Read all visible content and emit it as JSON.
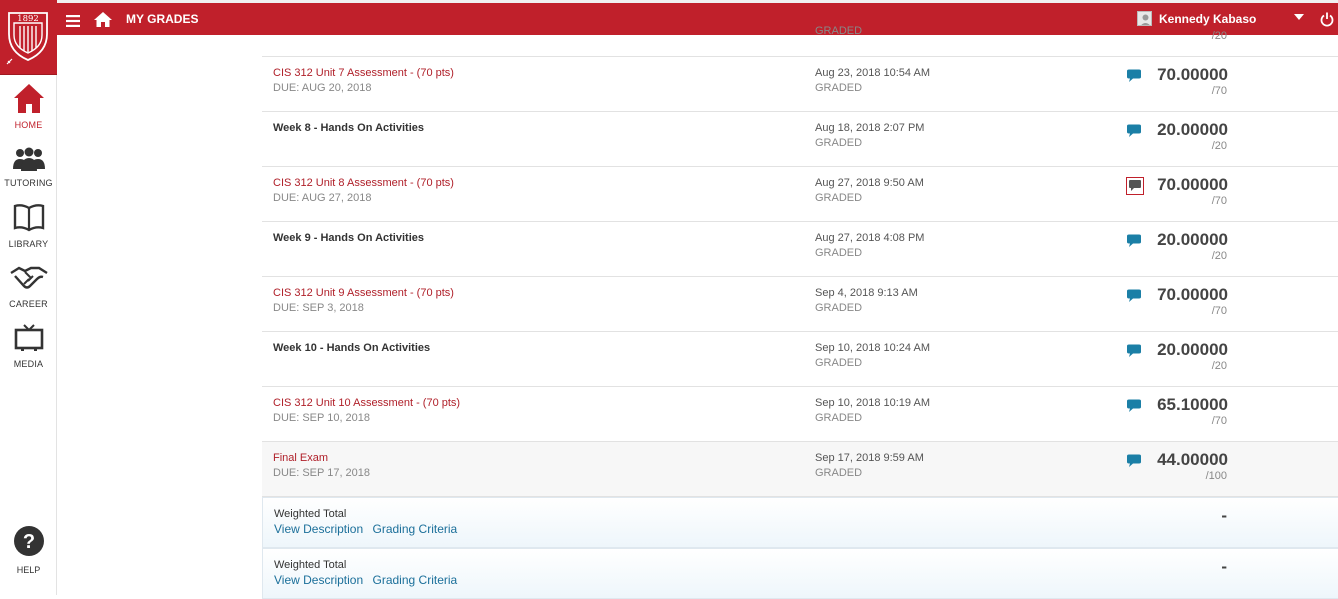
{
  "header": {
    "title": "MY GRADES",
    "user_name": "Kennedy Kabaso",
    "logo_year": "1892"
  },
  "sidebar": {
    "items": [
      {
        "label": "HOME",
        "icon": "home-icon"
      },
      {
        "label": "TUTORING",
        "icon": "people-icon"
      },
      {
        "label": "LIBRARY",
        "icon": "book-icon"
      },
      {
        "label": "CAREER",
        "icon": "handshake-icon"
      },
      {
        "label": "MEDIA",
        "icon": "tv-icon"
      }
    ],
    "help_label": "HELP"
  },
  "partial_row": {
    "status": "GRADED",
    "possible": "/20"
  },
  "grades": [
    {
      "name": "CIS 312 Unit 7 Assessment - (70 pts)",
      "due": "DUE: AUG 20, 2018",
      "date": "Aug 23, 2018 10:54 AM",
      "status": "GRADED",
      "score": "70.00000",
      "possible": "/70",
      "link": true,
      "comment_new": false
    },
    {
      "name": "Week 8 - Hands On Activities",
      "due": "",
      "date": "Aug 18, 2018 2:07 PM",
      "status": "GRADED",
      "score": "20.00000",
      "possible": "/20",
      "link": false,
      "comment_new": false
    },
    {
      "name": "CIS 312 Unit 8 Assessment - (70 pts)",
      "due": "DUE: AUG 27, 2018",
      "date": "Aug 27, 2018 9:50 AM",
      "status": "GRADED",
      "score": "70.00000",
      "possible": "/70",
      "link": true,
      "comment_new": true
    },
    {
      "name": "Week 9 - Hands On Activities",
      "due": "",
      "date": "Aug 27, 2018 4:08 PM",
      "status": "GRADED",
      "score": "20.00000",
      "possible": "/20",
      "link": false,
      "comment_new": false
    },
    {
      "name": "CIS 312 Unit 9 Assessment - (70 pts)",
      "due": "DUE: SEP 3, 2018",
      "date": "Sep 4, 2018 9:13 AM",
      "status": "GRADED",
      "score": "70.00000",
      "possible": "/70",
      "link": true,
      "comment_new": false
    },
    {
      "name": "Week 10 - Hands On Activities",
      "due": "",
      "date": "Sep 10, 2018 10:24 AM",
      "status": "GRADED",
      "score": "20.00000",
      "possible": "/20",
      "link": false,
      "comment_new": false
    },
    {
      "name": "CIS 312 Unit 10 Assessment - (70 pts)",
      "due": "DUE: SEP 10, 2018",
      "date": "Sep 10, 2018 10:19 AM",
      "status": "GRADED",
      "score": "65.10000",
      "possible": "/70",
      "link": true,
      "comment_new": false
    },
    {
      "name": "Final Exam",
      "due": "DUE: SEP 17, 2018",
      "date": "Sep 17, 2018 9:59 AM",
      "status": "GRADED",
      "score": "44.00000",
      "possible": "/100",
      "link": true,
      "comment_new": false
    }
  ],
  "totals": [
    {
      "label": "Weighted Total",
      "view_description": "View Description",
      "grading_criteria": "Grading Criteria",
      "value": "-"
    },
    {
      "label": "Weighted Total",
      "view_description": "View Description",
      "grading_criteria": "Grading Criteria",
      "value": "-"
    }
  ],
  "colors": {
    "brand": "#c0202b",
    "link": "#1b6f9a",
    "comment_icon": "#1b7fa6"
  }
}
